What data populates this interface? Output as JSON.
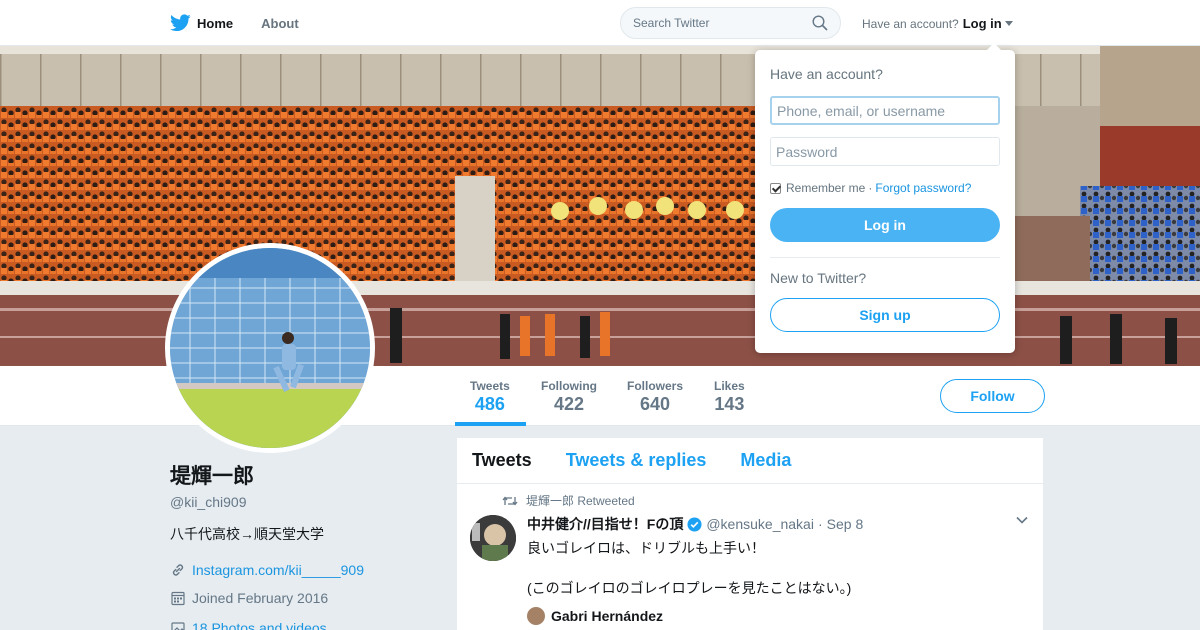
{
  "nav": {
    "home_label": "Home",
    "about_label": "About",
    "search_placeholder": "Search Twitter",
    "have_account": "Have an account?",
    "login_label": "Log in"
  },
  "stats": {
    "tweets_label": "Tweets",
    "tweets_value": "486",
    "following_label": "Following",
    "following_value": "422",
    "followers_label": "Followers",
    "followers_value": "640",
    "likes_label": "Likes",
    "likes_value": "143",
    "follow_label": "Follow"
  },
  "profile": {
    "name": "堤輝一郎",
    "handle": "@kii_chi909",
    "bio": "八千代高校→順天堂大学",
    "website": "Instagram.com/kii_____909",
    "joined": "Joined February 2016",
    "photos": "18 Photos and videos"
  },
  "timeline": {
    "tabs": [
      "Tweets",
      "Tweets & replies",
      "Media"
    ],
    "tweet": {
      "retweeted_by": "堤輝一郎 Retweeted",
      "name": "中井健介//目指せ！Fの頂",
      "handle": "@kensuke_nakai",
      "date": "Sep 8",
      "line1": "良いゴレイロは、ドリブルも上手い！",
      "line2": "(このゴレイロのゴレイロプレーを見たことはない。)",
      "quoted_name": "Gabri Hernández"
    }
  },
  "login_dropdown": {
    "title": "Have an account?",
    "username_placeholder": "Phone, email, or username",
    "password_placeholder": "Password",
    "remember_label": "Remember me",
    "separator": "·",
    "forgot_label": "Forgot password?",
    "login_button": "Log in",
    "new_label": "New to Twitter?",
    "signup_button": "Sign up"
  },
  "colors": {
    "accent": "#1da1f2",
    "background": "#e6ecf0",
    "banner_crowd": "#e8742a"
  }
}
